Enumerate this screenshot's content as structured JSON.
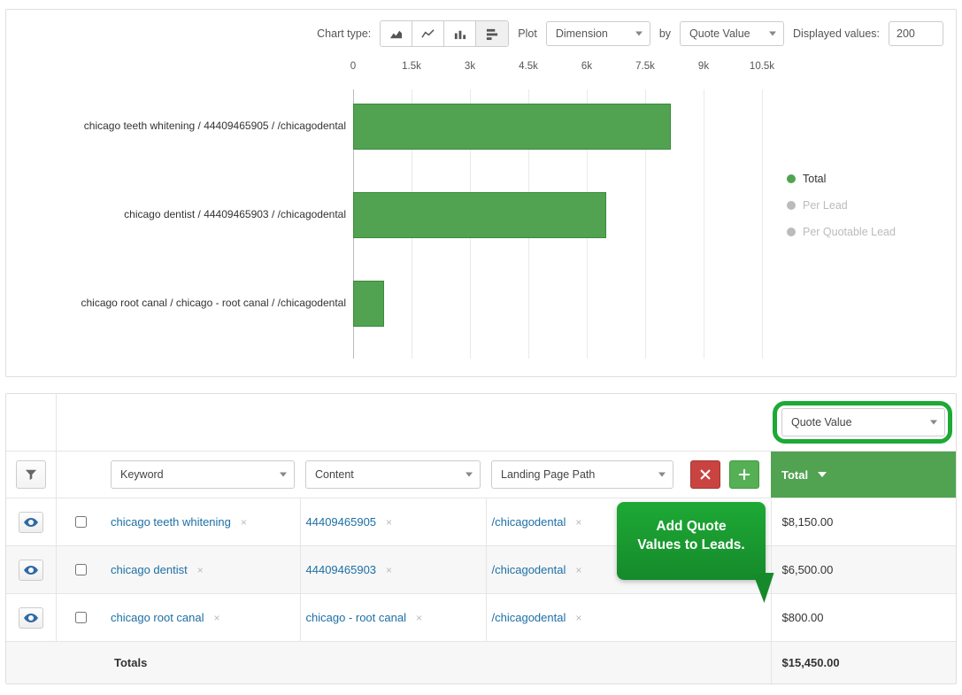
{
  "toolbar": {
    "chart_type_label": "Chart type:",
    "plot_label": "Plot",
    "by_label": "by",
    "displayed_values_label": "Displayed values:",
    "plot_select": "Dimension",
    "by_select": "Quote Value",
    "displayed_values": "200"
  },
  "chart_data": {
    "type": "bar",
    "orientation": "horizontal",
    "x_ticks": [
      "0",
      "1.5k",
      "3k",
      "4.5k",
      "6k",
      "7.5k",
      "9k",
      "10.5k"
    ],
    "x_range": [
      0,
      10500
    ],
    "categories": [
      "chicago teeth whitening / 44409465905 / /chicagodental",
      "chicago dentist / 44409465903 / /chicagodental",
      "chicago root canal / chicago - root canal / /chicagodental"
    ],
    "series": [
      {
        "name": "Total",
        "color": "#51a351",
        "values": [
          8150,
          6500,
          800
        ]
      }
    ],
    "legend": [
      {
        "label": "Total",
        "active": true,
        "color": "#51a351"
      },
      {
        "label": "Per Lead",
        "active": false,
        "color": "#bbbbbb"
      },
      {
        "label": "Per Quotable Lead",
        "active": false,
        "color": "#bbbbbb"
      }
    ]
  },
  "table": {
    "filter_icon": "filter-icon",
    "columns": {
      "keyword": "Keyword",
      "content": "Content",
      "landing": "Landing Page Path"
    },
    "value_select": "Quote Value",
    "total_header": "Total",
    "rows": [
      {
        "keyword": "chicago teeth whitening",
        "content": "44409465905",
        "landing": "/chicagodental",
        "total": "$8,150.00"
      },
      {
        "keyword": "chicago dentist",
        "content": "44409465903",
        "landing": "/chicagodental",
        "total": "$6,500.00"
      },
      {
        "keyword": "chicago root canal",
        "content": "chicago - root canal",
        "landing": "/chicagodental",
        "total": "$800.00"
      }
    ],
    "totals_label": "Totals",
    "totals_value": "$15,450.00"
  },
  "callout": {
    "line1": "Add Quote",
    "line2": "Values to Leads."
  }
}
